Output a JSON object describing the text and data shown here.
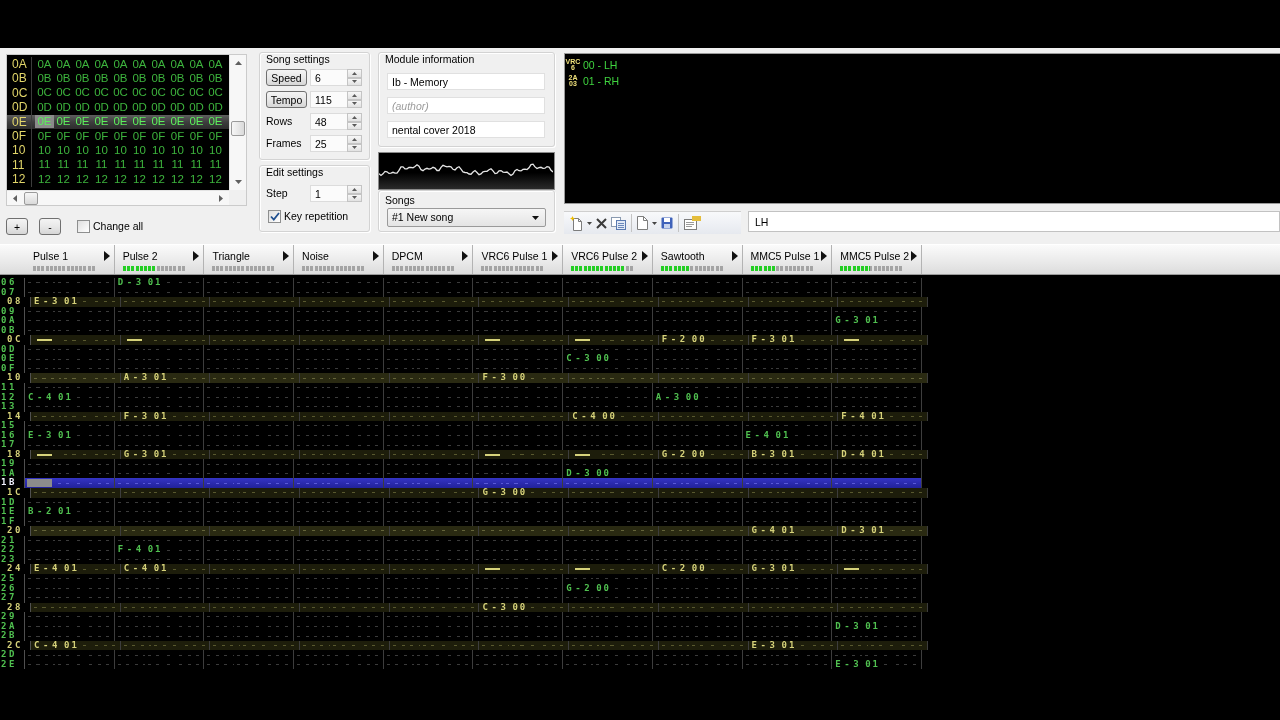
{
  "frames": {
    "rows": [
      {
        "number": "0A",
        "selected": false,
        "patterns": [
          "0A",
          "0A",
          "0A",
          "0A",
          "0A",
          "0A",
          "0A",
          "0A",
          "0A",
          "0A"
        ]
      },
      {
        "number": "0B",
        "selected": false,
        "patterns": [
          "0B",
          "0B",
          "0B",
          "0B",
          "0B",
          "0B",
          "0B",
          "0B",
          "0B",
          "0B"
        ]
      },
      {
        "number": "0C",
        "selected": false,
        "patterns": [
          "0C",
          "0C",
          "0C",
          "0C",
          "0C",
          "0C",
          "0C",
          "0C",
          "0C",
          "0C"
        ]
      },
      {
        "number": "0D",
        "selected": false,
        "patterns": [
          "0D",
          "0D",
          "0D",
          "0D",
          "0D",
          "0D",
          "0D",
          "0D",
          "0D",
          "0D"
        ]
      },
      {
        "number": "0E",
        "selected": true,
        "patterns": [
          "0E",
          "0E",
          "0E",
          "0E",
          "0E",
          "0E",
          "0E",
          "0E",
          "0E",
          "0E"
        ]
      },
      {
        "number": "0F",
        "selected": false,
        "patterns": [
          "0F",
          "0F",
          "0F",
          "0F",
          "0F",
          "0F",
          "0F",
          "0F",
          "0F",
          "0F"
        ]
      },
      {
        "number": "10",
        "selected": false,
        "patterns": [
          "10",
          "10",
          "10",
          "10",
          "10",
          "10",
          "10",
          "10",
          "10",
          "10"
        ]
      },
      {
        "number": "11",
        "selected": false,
        "patterns": [
          "11",
          "11",
          "11",
          "11",
          "11",
          "11",
          "11",
          "11",
          "11",
          "11"
        ]
      },
      {
        "number": "12",
        "selected": false,
        "patterns": [
          "12",
          "12",
          "12",
          "12",
          "12",
          "12",
          "12",
          "12",
          "12",
          "12"
        ]
      }
    ]
  },
  "frame_buttons": [
    "+",
    "-"
  ],
  "change_all": {
    "label": "Change all",
    "checked": false
  },
  "song_settings": {
    "title": "Song settings",
    "fields": [
      {
        "kind": "button",
        "label": "Speed",
        "value": "6"
      },
      {
        "kind": "button",
        "label": "Tempo",
        "value": "115"
      },
      {
        "kind": "label",
        "label": "Rows",
        "value": "48"
      },
      {
        "kind": "label",
        "label": "Frames",
        "value": "25"
      }
    ]
  },
  "edit_settings": {
    "title": "Edit settings",
    "step": {
      "label": "Step",
      "value": "1"
    },
    "key_repetition": {
      "label": "Key repetition",
      "checked": true
    }
  },
  "module_information": {
    "title": "Module information",
    "fields": [
      {
        "value": "Ib - Memory"
      },
      {
        "placeholder": "(author)"
      },
      {
        "value": "nental cover 2018"
      }
    ]
  },
  "songs": {
    "title": "Songs",
    "selected_song": "#1 New song"
  },
  "instruments": [
    {
      "chip": [
        "VRC",
        "6"
      ],
      "name": "00 - LH"
    },
    {
      "chip": [
        "2A",
        "03"
      ],
      "name": "01 - RH"
    }
  ],
  "instrument_name": {
    "value": "LH"
  },
  "channels": [
    {
      "name": "Pulse 1",
      "level": 0
    },
    {
      "name": "Pulse 2",
      "level": 0.53
    },
    {
      "name": "Triangle",
      "level": 0
    },
    {
      "name": "Noise",
      "level": 0
    },
    {
      "name": "DPCM",
      "level": 0
    },
    {
      "name": "VRC6 Pulse 1",
      "level": 0
    },
    {
      "name": "VRC6 Pulse 2",
      "level": 0.87
    },
    {
      "name": "Sawtooth",
      "level": 0.47
    },
    {
      "name": "MMC5 Pulse 1",
      "level": 0.4
    },
    {
      "name": "MMC5 Pulse 2",
      "level": 0.47
    }
  ],
  "pattern": {
    "rows": [
      {
        "number": "06",
        "highlighted": false,
        "measure": false,
        "cursor": false,
        "cells": [
          {
            "kind": "empty"
          },
          {
            "kind": "note",
            "note": "D-3",
            "instrument": "01"
          },
          {
            "kind": "empty"
          },
          {
            "kind": "empty"
          },
          {
            "kind": "empty"
          },
          {
            "kind": "empty"
          },
          {
            "kind": "empty"
          },
          {
            "kind": "empty"
          },
          {
            "kind": "empty"
          },
          {
            "kind": "empty"
          }
        ]
      },
      {
        "number": "07",
        "highlighted": false,
        "measure": false,
        "cursor": false,
        "cells": [
          {
            "kind": "empty"
          },
          {
            "kind": "empty"
          },
          {
            "kind": "empty"
          },
          {
            "kind": "empty"
          },
          {
            "kind": "empty"
          },
          {
            "kind": "empty"
          },
          {
            "kind": "empty"
          },
          {
            "kind": "empty"
          },
          {
            "kind": "empty"
          },
          {
            "kind": "empty"
          }
        ]
      },
      {
        "number": "08",
        "highlighted": true,
        "measure": false,
        "cursor": false,
        "cells": [
          {
            "kind": "note",
            "note": "E-3",
            "instrument": "01"
          },
          {
            "kind": "empty"
          },
          {
            "kind": "empty"
          },
          {
            "kind": "empty"
          },
          {
            "kind": "empty"
          },
          {
            "kind": "empty"
          },
          {
            "kind": "empty"
          },
          {
            "kind": "empty"
          },
          {
            "kind": "empty"
          },
          {
            "kind": "empty"
          }
        ]
      },
      {
        "number": "09",
        "highlighted": false,
        "measure": false,
        "cursor": false,
        "cells": [
          {
            "kind": "empty"
          },
          {
            "kind": "empty"
          },
          {
            "kind": "empty"
          },
          {
            "kind": "empty"
          },
          {
            "kind": "empty"
          },
          {
            "kind": "empty"
          },
          {
            "kind": "empty"
          },
          {
            "kind": "empty"
          },
          {
            "kind": "empty"
          },
          {
            "kind": "empty"
          }
        ]
      },
      {
        "number": "0A",
        "highlighted": false,
        "measure": false,
        "cursor": false,
        "cells": [
          {
            "kind": "empty"
          },
          {
            "kind": "empty"
          },
          {
            "kind": "empty"
          },
          {
            "kind": "empty"
          },
          {
            "kind": "empty"
          },
          {
            "kind": "empty"
          },
          {
            "kind": "empty"
          },
          {
            "kind": "empty"
          },
          {
            "kind": "empty"
          },
          {
            "kind": "note",
            "note": "G-3",
            "instrument": "01"
          }
        ]
      },
      {
        "number": "0B",
        "highlighted": false,
        "measure": false,
        "cursor": false,
        "cells": [
          {
            "kind": "empty"
          },
          {
            "kind": "empty"
          },
          {
            "kind": "empty"
          },
          {
            "kind": "empty"
          },
          {
            "kind": "empty"
          },
          {
            "kind": "empty"
          },
          {
            "kind": "empty"
          },
          {
            "kind": "empty"
          },
          {
            "kind": "empty"
          },
          {
            "kind": "empty"
          }
        ]
      },
      {
        "number": "0C",
        "highlighted": true,
        "measure": false,
        "cursor": false,
        "cells": [
          {
            "kind": "off"
          },
          {
            "kind": "off"
          },
          {
            "kind": "empty"
          },
          {
            "kind": "empty"
          },
          {
            "kind": "empty"
          },
          {
            "kind": "off"
          },
          {
            "kind": "off"
          },
          {
            "kind": "note",
            "note": "F-2",
            "instrument": "00"
          },
          {
            "kind": "note",
            "note": "F-3",
            "instrument": "01"
          },
          {
            "kind": "off"
          }
        ]
      },
      {
        "number": "0D",
        "highlighted": false,
        "measure": false,
        "cursor": false,
        "cells": [
          {
            "kind": "empty"
          },
          {
            "kind": "empty"
          },
          {
            "kind": "empty"
          },
          {
            "kind": "empty"
          },
          {
            "kind": "empty"
          },
          {
            "kind": "empty"
          },
          {
            "kind": "empty"
          },
          {
            "kind": "empty"
          },
          {
            "kind": "empty"
          },
          {
            "kind": "empty"
          }
        ]
      },
      {
        "number": "0E",
        "highlighted": false,
        "measure": false,
        "cursor": false,
        "cells": [
          {
            "kind": "empty"
          },
          {
            "kind": "empty"
          },
          {
            "kind": "empty"
          },
          {
            "kind": "empty"
          },
          {
            "kind": "empty"
          },
          {
            "kind": "empty"
          },
          {
            "kind": "note",
            "note": "C-3",
            "instrument": "00"
          },
          {
            "kind": "empty"
          },
          {
            "kind": "empty"
          },
          {
            "kind": "empty"
          }
        ]
      },
      {
        "number": "0F",
        "highlighted": false,
        "measure": false,
        "cursor": false,
        "cells": [
          {
            "kind": "empty"
          },
          {
            "kind": "empty"
          },
          {
            "kind": "empty"
          },
          {
            "kind": "empty"
          },
          {
            "kind": "empty"
          },
          {
            "kind": "empty"
          },
          {
            "kind": "empty"
          },
          {
            "kind": "empty"
          },
          {
            "kind": "empty"
          },
          {
            "kind": "empty"
          }
        ]
      },
      {
        "number": "10",
        "highlighted": true,
        "measure": true,
        "cursor": false,
        "cells": [
          {
            "kind": "empty"
          },
          {
            "kind": "note",
            "note": "A-3",
            "instrument": "01"
          },
          {
            "kind": "empty"
          },
          {
            "kind": "empty"
          },
          {
            "kind": "empty"
          },
          {
            "kind": "note",
            "note": "F-3",
            "instrument": "00"
          },
          {
            "kind": "empty"
          },
          {
            "kind": "empty"
          },
          {
            "kind": "empty"
          },
          {
            "kind": "empty"
          }
        ]
      },
      {
        "number": "11",
        "highlighted": false,
        "measure": false,
        "cursor": false,
        "cells": [
          {
            "kind": "empty"
          },
          {
            "kind": "empty"
          },
          {
            "kind": "empty"
          },
          {
            "kind": "empty"
          },
          {
            "kind": "empty"
          },
          {
            "kind": "empty"
          },
          {
            "kind": "empty"
          },
          {
            "kind": "empty"
          },
          {
            "kind": "empty"
          },
          {
            "kind": "empty"
          }
        ]
      },
      {
        "number": "12",
        "highlighted": false,
        "measure": false,
        "cursor": false,
        "cells": [
          {
            "kind": "note",
            "note": "C-4",
            "instrument": "01"
          },
          {
            "kind": "empty"
          },
          {
            "kind": "empty"
          },
          {
            "kind": "empty"
          },
          {
            "kind": "empty"
          },
          {
            "kind": "empty"
          },
          {
            "kind": "empty"
          },
          {
            "kind": "note",
            "note": "A-3",
            "instrument": "00"
          },
          {
            "kind": "empty"
          },
          {
            "kind": "empty"
          }
        ]
      },
      {
        "number": "13",
        "highlighted": false,
        "measure": false,
        "cursor": false,
        "cells": [
          {
            "kind": "empty"
          },
          {
            "kind": "empty"
          },
          {
            "kind": "empty"
          },
          {
            "kind": "empty"
          },
          {
            "kind": "empty"
          },
          {
            "kind": "empty"
          },
          {
            "kind": "empty"
          },
          {
            "kind": "empty"
          },
          {
            "kind": "empty"
          },
          {
            "kind": "empty"
          }
        ]
      },
      {
        "number": "14",
        "highlighted": true,
        "measure": false,
        "cursor": false,
        "cells": [
          {
            "kind": "empty"
          },
          {
            "kind": "note",
            "note": "F-3",
            "instrument": "01"
          },
          {
            "kind": "empty"
          },
          {
            "kind": "empty"
          },
          {
            "kind": "empty"
          },
          {
            "kind": "empty"
          },
          {
            "kind": "note",
            "note": "C-4",
            "instrument": "00"
          },
          {
            "kind": "empty"
          },
          {
            "kind": "empty"
          },
          {
            "kind": "note",
            "note": "F-4",
            "instrument": "01"
          }
        ]
      },
      {
        "number": "15",
        "highlighted": false,
        "measure": false,
        "cursor": false,
        "cells": [
          {
            "kind": "empty"
          },
          {
            "kind": "empty"
          },
          {
            "kind": "empty"
          },
          {
            "kind": "empty"
          },
          {
            "kind": "empty"
          },
          {
            "kind": "empty"
          },
          {
            "kind": "empty"
          },
          {
            "kind": "empty"
          },
          {
            "kind": "empty"
          },
          {
            "kind": "empty"
          }
        ]
      },
      {
        "number": "16",
        "highlighted": false,
        "measure": false,
        "cursor": false,
        "cells": [
          {
            "kind": "note",
            "note": "E-3",
            "instrument": "01"
          },
          {
            "kind": "empty"
          },
          {
            "kind": "empty"
          },
          {
            "kind": "empty"
          },
          {
            "kind": "empty"
          },
          {
            "kind": "empty"
          },
          {
            "kind": "empty"
          },
          {
            "kind": "empty"
          },
          {
            "kind": "note",
            "note": "E-4",
            "instrument": "01"
          },
          {
            "kind": "empty"
          }
        ]
      },
      {
        "number": "17",
        "highlighted": false,
        "measure": false,
        "cursor": false,
        "cells": [
          {
            "kind": "empty"
          },
          {
            "kind": "empty"
          },
          {
            "kind": "empty"
          },
          {
            "kind": "empty"
          },
          {
            "kind": "empty"
          },
          {
            "kind": "empty"
          },
          {
            "kind": "empty"
          },
          {
            "kind": "empty"
          },
          {
            "kind": "empty"
          },
          {
            "kind": "empty"
          }
        ]
      },
      {
        "number": "18",
        "highlighted": true,
        "measure": false,
        "cursor": false,
        "cells": [
          {
            "kind": "off"
          },
          {
            "kind": "note",
            "note": "G-3",
            "instrument": "01"
          },
          {
            "kind": "empty"
          },
          {
            "kind": "empty"
          },
          {
            "kind": "empty"
          },
          {
            "kind": "off"
          },
          {
            "kind": "off"
          },
          {
            "kind": "note",
            "note": "G-2",
            "instrument": "00"
          },
          {
            "kind": "note",
            "note": "B-3",
            "instrument": "01"
          },
          {
            "kind": "note",
            "note": "D-4",
            "instrument": "01"
          }
        ]
      },
      {
        "number": "19",
        "highlighted": false,
        "measure": false,
        "cursor": false,
        "cells": [
          {
            "kind": "empty"
          },
          {
            "kind": "empty"
          },
          {
            "kind": "empty"
          },
          {
            "kind": "empty"
          },
          {
            "kind": "empty"
          },
          {
            "kind": "empty"
          },
          {
            "kind": "empty"
          },
          {
            "kind": "empty"
          },
          {
            "kind": "empty"
          },
          {
            "kind": "empty"
          }
        ]
      },
      {
        "number": "1A",
        "highlighted": false,
        "measure": false,
        "cursor": false,
        "cells": [
          {
            "kind": "empty"
          },
          {
            "kind": "empty"
          },
          {
            "kind": "empty"
          },
          {
            "kind": "empty"
          },
          {
            "kind": "empty"
          },
          {
            "kind": "empty"
          },
          {
            "kind": "note",
            "note": "D-3",
            "instrument": "00"
          },
          {
            "kind": "empty"
          },
          {
            "kind": "empty"
          },
          {
            "kind": "empty"
          }
        ]
      },
      {
        "number": "1B",
        "highlighted": false,
        "measure": false,
        "cursor": true,
        "cells": [
          {
            "kind": "empty"
          },
          {
            "kind": "empty"
          },
          {
            "kind": "empty"
          },
          {
            "kind": "empty"
          },
          {
            "kind": "empty"
          },
          {
            "kind": "empty"
          },
          {
            "kind": "empty"
          },
          {
            "kind": "empty"
          },
          {
            "kind": "empty"
          },
          {
            "kind": "empty"
          }
        ]
      },
      {
        "number": "1C",
        "highlighted": true,
        "measure": false,
        "cursor": false,
        "cells": [
          {
            "kind": "empty"
          },
          {
            "kind": "empty"
          },
          {
            "kind": "empty"
          },
          {
            "kind": "empty"
          },
          {
            "kind": "empty"
          },
          {
            "kind": "note",
            "note": "G-3",
            "instrument": "00"
          },
          {
            "kind": "empty"
          },
          {
            "kind": "empty"
          },
          {
            "kind": "empty"
          },
          {
            "kind": "empty"
          }
        ]
      },
      {
        "number": "1D",
        "highlighted": false,
        "measure": false,
        "cursor": false,
        "cells": [
          {
            "kind": "empty"
          },
          {
            "kind": "empty"
          },
          {
            "kind": "empty"
          },
          {
            "kind": "empty"
          },
          {
            "kind": "empty"
          },
          {
            "kind": "empty"
          },
          {
            "kind": "empty"
          },
          {
            "kind": "empty"
          },
          {
            "kind": "empty"
          },
          {
            "kind": "empty"
          }
        ]
      },
      {
        "number": "1E",
        "highlighted": false,
        "measure": false,
        "cursor": false,
        "cells": [
          {
            "kind": "note",
            "note": "B-2",
            "instrument": "01"
          },
          {
            "kind": "empty"
          },
          {
            "kind": "empty"
          },
          {
            "kind": "empty"
          },
          {
            "kind": "empty"
          },
          {
            "kind": "empty"
          },
          {
            "kind": "empty"
          },
          {
            "kind": "empty"
          },
          {
            "kind": "empty"
          },
          {
            "kind": "empty"
          }
        ]
      },
      {
        "number": "1F",
        "highlighted": false,
        "measure": false,
        "cursor": false,
        "cells": [
          {
            "kind": "empty"
          },
          {
            "kind": "empty"
          },
          {
            "kind": "empty"
          },
          {
            "kind": "empty"
          },
          {
            "kind": "empty"
          },
          {
            "kind": "empty"
          },
          {
            "kind": "empty"
          },
          {
            "kind": "empty"
          },
          {
            "kind": "empty"
          },
          {
            "kind": "empty"
          }
        ]
      },
      {
        "number": "20",
        "highlighted": true,
        "measure": true,
        "cursor": false,
        "cells": [
          {
            "kind": "empty"
          },
          {
            "kind": "empty"
          },
          {
            "kind": "empty"
          },
          {
            "kind": "empty"
          },
          {
            "kind": "empty"
          },
          {
            "kind": "empty"
          },
          {
            "kind": "empty"
          },
          {
            "kind": "empty"
          },
          {
            "kind": "note",
            "note": "G-4",
            "instrument": "01"
          },
          {
            "kind": "note",
            "note": "D-3",
            "instrument": "01"
          }
        ]
      },
      {
        "number": "21",
        "highlighted": false,
        "measure": false,
        "cursor": false,
        "cells": [
          {
            "kind": "empty"
          },
          {
            "kind": "empty"
          },
          {
            "kind": "empty"
          },
          {
            "kind": "empty"
          },
          {
            "kind": "empty"
          },
          {
            "kind": "empty"
          },
          {
            "kind": "empty"
          },
          {
            "kind": "empty"
          },
          {
            "kind": "empty"
          },
          {
            "kind": "empty"
          }
        ]
      },
      {
        "number": "22",
        "highlighted": false,
        "measure": false,
        "cursor": false,
        "cells": [
          {
            "kind": "empty"
          },
          {
            "kind": "note",
            "note": "F-4",
            "instrument": "01"
          },
          {
            "kind": "empty"
          },
          {
            "kind": "empty"
          },
          {
            "kind": "empty"
          },
          {
            "kind": "empty"
          },
          {
            "kind": "empty"
          },
          {
            "kind": "empty"
          },
          {
            "kind": "empty"
          },
          {
            "kind": "empty"
          }
        ]
      },
      {
        "number": "23",
        "highlighted": false,
        "measure": false,
        "cursor": false,
        "cells": [
          {
            "kind": "empty"
          },
          {
            "kind": "empty"
          },
          {
            "kind": "empty"
          },
          {
            "kind": "empty"
          },
          {
            "kind": "empty"
          },
          {
            "kind": "empty"
          },
          {
            "kind": "empty"
          },
          {
            "kind": "empty"
          },
          {
            "kind": "empty"
          },
          {
            "kind": "empty"
          }
        ]
      },
      {
        "number": "24",
        "highlighted": true,
        "measure": false,
        "cursor": false,
        "cells": [
          {
            "kind": "note",
            "note": "E-4",
            "instrument": "01"
          },
          {
            "kind": "note",
            "note": "C-4",
            "instrument": "01"
          },
          {
            "kind": "empty"
          },
          {
            "kind": "empty"
          },
          {
            "kind": "empty"
          },
          {
            "kind": "off"
          },
          {
            "kind": "off"
          },
          {
            "kind": "note",
            "note": "C-2",
            "instrument": "00"
          },
          {
            "kind": "note",
            "note": "G-3",
            "instrument": "01"
          },
          {
            "kind": "off"
          }
        ]
      },
      {
        "number": "25",
        "highlighted": false,
        "measure": false,
        "cursor": false,
        "cells": [
          {
            "kind": "empty"
          },
          {
            "kind": "empty"
          },
          {
            "kind": "empty"
          },
          {
            "kind": "empty"
          },
          {
            "kind": "empty"
          },
          {
            "kind": "empty"
          },
          {
            "kind": "empty"
          },
          {
            "kind": "empty"
          },
          {
            "kind": "empty"
          },
          {
            "kind": "empty"
          }
        ]
      },
      {
        "number": "26",
        "highlighted": false,
        "measure": false,
        "cursor": false,
        "cells": [
          {
            "kind": "empty"
          },
          {
            "kind": "empty"
          },
          {
            "kind": "empty"
          },
          {
            "kind": "empty"
          },
          {
            "kind": "empty"
          },
          {
            "kind": "empty"
          },
          {
            "kind": "note",
            "note": "G-2",
            "instrument": "00"
          },
          {
            "kind": "empty"
          },
          {
            "kind": "empty"
          },
          {
            "kind": "empty"
          }
        ]
      },
      {
        "number": "27",
        "highlighted": false,
        "measure": false,
        "cursor": false,
        "cells": [
          {
            "kind": "empty"
          },
          {
            "kind": "empty"
          },
          {
            "kind": "empty"
          },
          {
            "kind": "empty"
          },
          {
            "kind": "empty"
          },
          {
            "kind": "empty"
          },
          {
            "kind": "empty"
          },
          {
            "kind": "empty"
          },
          {
            "kind": "empty"
          },
          {
            "kind": "empty"
          }
        ]
      },
      {
        "number": "28",
        "highlighted": true,
        "measure": false,
        "cursor": false,
        "cells": [
          {
            "kind": "empty"
          },
          {
            "kind": "empty"
          },
          {
            "kind": "empty"
          },
          {
            "kind": "empty"
          },
          {
            "kind": "empty"
          },
          {
            "kind": "note",
            "note": "C-3",
            "instrument": "00"
          },
          {
            "kind": "empty"
          },
          {
            "kind": "empty"
          },
          {
            "kind": "empty"
          },
          {
            "kind": "empty"
          }
        ]
      },
      {
        "number": "29",
        "highlighted": false,
        "measure": false,
        "cursor": false,
        "cells": [
          {
            "kind": "empty"
          },
          {
            "kind": "empty"
          },
          {
            "kind": "empty"
          },
          {
            "kind": "empty"
          },
          {
            "kind": "empty"
          },
          {
            "kind": "empty"
          },
          {
            "kind": "empty"
          },
          {
            "kind": "empty"
          },
          {
            "kind": "empty"
          },
          {
            "kind": "empty"
          }
        ]
      },
      {
        "number": "2A",
        "highlighted": false,
        "measure": false,
        "cursor": false,
        "cells": [
          {
            "kind": "empty"
          },
          {
            "kind": "empty"
          },
          {
            "kind": "empty"
          },
          {
            "kind": "empty"
          },
          {
            "kind": "empty"
          },
          {
            "kind": "empty"
          },
          {
            "kind": "empty"
          },
          {
            "kind": "empty"
          },
          {
            "kind": "empty"
          },
          {
            "kind": "note",
            "note": "D-3",
            "instrument": "01"
          }
        ]
      },
      {
        "number": "2B",
        "highlighted": false,
        "measure": false,
        "cursor": false,
        "cells": [
          {
            "kind": "empty"
          },
          {
            "kind": "empty"
          },
          {
            "kind": "empty"
          },
          {
            "kind": "empty"
          },
          {
            "kind": "empty"
          },
          {
            "kind": "empty"
          },
          {
            "kind": "empty"
          },
          {
            "kind": "empty"
          },
          {
            "kind": "empty"
          },
          {
            "kind": "empty"
          }
        ]
      },
      {
        "number": "2C",
        "highlighted": true,
        "measure": false,
        "cursor": false,
        "cells": [
          {
            "kind": "note",
            "note": "C-4",
            "instrument": "01"
          },
          {
            "kind": "empty"
          },
          {
            "kind": "empty"
          },
          {
            "kind": "empty"
          },
          {
            "kind": "empty"
          },
          {
            "kind": "empty"
          },
          {
            "kind": "empty"
          },
          {
            "kind": "empty"
          },
          {
            "kind": "note",
            "note": "E-3",
            "instrument": "01"
          },
          {
            "kind": "empty"
          }
        ]
      },
      {
        "number": "2D",
        "highlighted": false,
        "measure": false,
        "cursor": false,
        "cells": [
          {
            "kind": "empty"
          },
          {
            "kind": "empty"
          },
          {
            "kind": "empty"
          },
          {
            "kind": "empty"
          },
          {
            "kind": "empty"
          },
          {
            "kind": "empty"
          },
          {
            "kind": "empty"
          },
          {
            "kind": "empty"
          },
          {
            "kind": "empty"
          },
          {
            "kind": "empty"
          }
        ]
      },
      {
        "number": "2E",
        "highlighted": false,
        "measure": false,
        "cursor": false,
        "cells": [
          {
            "kind": "empty"
          },
          {
            "kind": "empty"
          },
          {
            "kind": "empty"
          },
          {
            "kind": "empty"
          },
          {
            "kind": "empty"
          },
          {
            "kind": "empty"
          },
          {
            "kind": "empty"
          },
          {
            "kind": "empty"
          },
          {
            "kind": "empty"
          },
          {
            "kind": "note",
            "note": "E-3",
            "instrument": "01"
          }
        ]
      }
    ]
  }
}
